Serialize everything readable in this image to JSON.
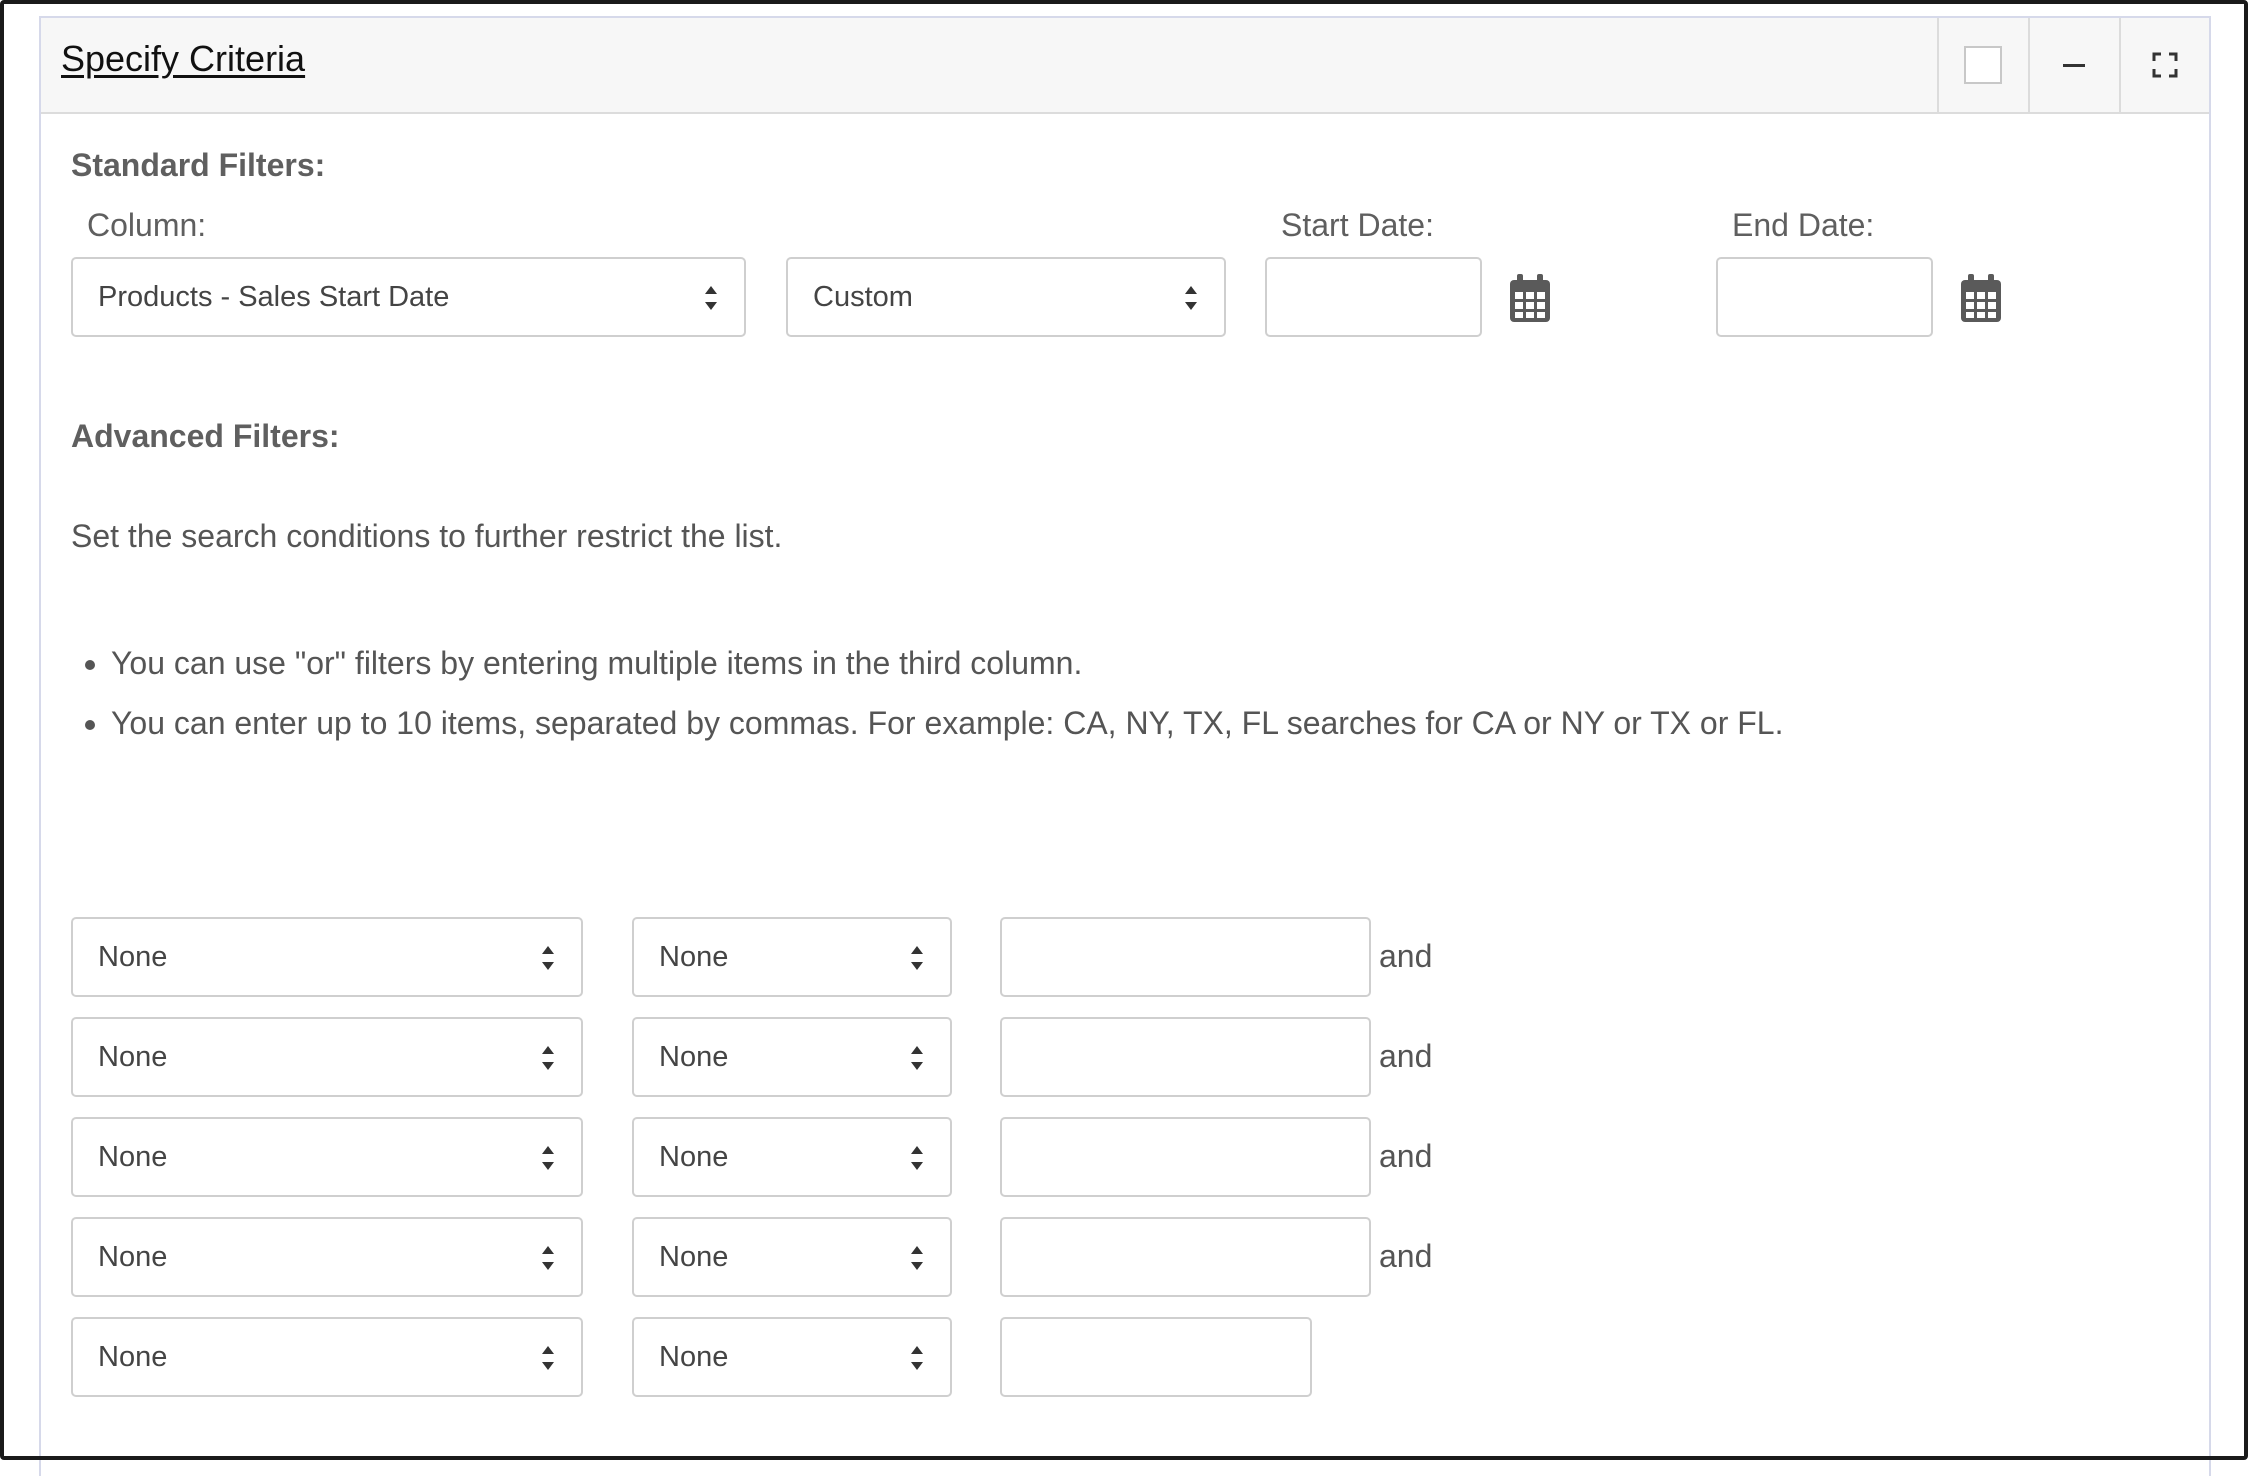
{
  "panel": {
    "title": "Specify Criteria",
    "header_icons": [
      "checkbox-icon",
      "minimize-icon",
      "expand-icon"
    ]
  },
  "standard_filters": {
    "heading": "Standard Filters:",
    "column_label": "Column:",
    "column_value": "Products - Sales Start Date",
    "range_value": "Custom",
    "start_date_label": "Start Date:",
    "start_date_value": "",
    "end_date_label": "End Date:",
    "end_date_value": ""
  },
  "advanced_filters": {
    "heading": "Advanced Filters:",
    "description": "Set the search conditions to further restrict the list.",
    "tips": [
      "You can use \"or\" filters by entering multiple items in the third column.",
      "You can enter up to 10 items, separated by commas. For example: CA, NY, TX, FL searches for CA or NY or TX or FL."
    ],
    "rows": [
      {
        "column": "None",
        "operator": "None",
        "value": "",
        "connector": "and"
      },
      {
        "column": "None",
        "operator": "None",
        "value": "",
        "connector": "and"
      },
      {
        "column": "None",
        "operator": "None",
        "value": "",
        "connector": "and"
      },
      {
        "column": "None",
        "operator": "None",
        "value": "",
        "connector": "and"
      },
      {
        "column": "None",
        "operator": "None",
        "value": "",
        "connector": ""
      }
    ]
  },
  "colors": {
    "panel_border": "#d6d9ea",
    "header_bg": "#f7f7f7",
    "text": "#555555",
    "input_border": "#cfcfcf"
  }
}
